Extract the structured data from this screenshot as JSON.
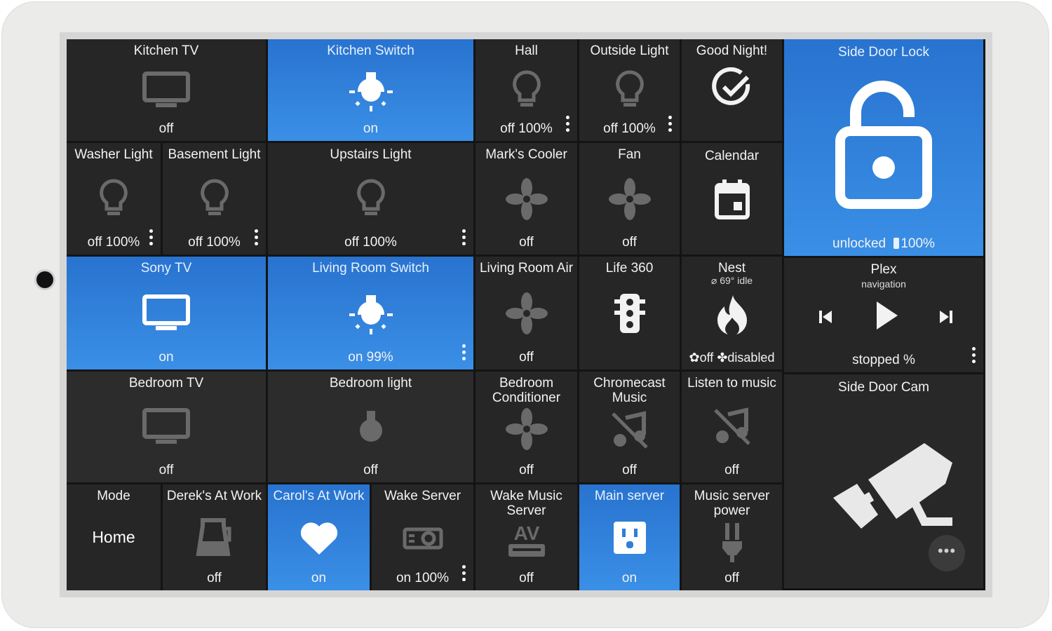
{
  "colors": {
    "accent_on": "#2f7fd8",
    "tile_off": "#262626",
    "icon_off": "#6a6a6a"
  },
  "tiles": {
    "kitchen_tv": {
      "title": "Kitchen TV",
      "state": "off",
      "icon": "tv-icon"
    },
    "kitchen_switch": {
      "title": "Kitchen Switch",
      "state": "on",
      "icon": "light-icon"
    },
    "hall": {
      "title": "Hall",
      "state": "off 100%",
      "icon": "bulb-icon"
    },
    "outside_light": {
      "title": "Outside Light",
      "state": "off 100%",
      "icon": "bulb-icon"
    },
    "good_night": {
      "title": "Good Night!",
      "icon": "checkmark-circle-icon"
    },
    "side_door_lock": {
      "title": "Side Door Lock",
      "state": "unlocked",
      "battery": "100%",
      "icon": "unlock-icon"
    },
    "washer_light": {
      "title": "Washer Light",
      "state": "off 100%",
      "icon": "bulb-icon"
    },
    "basement_light": {
      "title": "Basement Light",
      "state": "off 100%",
      "icon": "bulb-icon"
    },
    "upstairs_light": {
      "title": "Upstairs Light",
      "state": "off 100%",
      "icon": "bulb-icon"
    },
    "marks_cooler": {
      "title": "Mark's Cooler",
      "state": "off",
      "icon": "fan-icon"
    },
    "fan": {
      "title": "Fan",
      "state": "off",
      "icon": "fan-icon"
    },
    "calendar": {
      "title": "Calendar",
      "icon": "calendar-icon"
    },
    "sony_tv": {
      "title": "Sony TV",
      "state": "on",
      "icon": "tv-icon"
    },
    "living_room_switch": {
      "title": "Living Room Switch",
      "state": "on 99%",
      "icon": "light-icon"
    },
    "living_room_air": {
      "title": "Living Room Air",
      "state": "off",
      "icon": "fan-icon"
    },
    "life360": {
      "title": "Life 360",
      "icon": "traffic-light-icon"
    },
    "nest": {
      "title": "Nest",
      "sub": "69° idle",
      "state": "off",
      "state2": "disabled",
      "icon": "flame-icon"
    },
    "plex": {
      "title": "Plex",
      "sub": "navigation",
      "state": "stopped %",
      "icon": "play-icon"
    },
    "bedroom_tv": {
      "title": "Bedroom TV",
      "state": "off",
      "icon": "tv-icon"
    },
    "bedroom_light": {
      "title": "Bedroom light",
      "state": "off",
      "icon": "light-icon"
    },
    "bedroom_conditioner": {
      "title": "Bedroom Conditioner",
      "state": "off",
      "icon": "fan-icon"
    },
    "chromecast_music": {
      "title": "Chromecast Music",
      "state": "off",
      "icon": "music-off-icon"
    },
    "listen_to_music": {
      "title": "Listen to music",
      "state": "off",
      "icon": "music-off-icon"
    },
    "side_door_cam": {
      "title": "Side Door Cam",
      "icon": "security-camera-icon"
    },
    "mode": {
      "title": "Mode",
      "value": "Home"
    },
    "dereks_at_work": {
      "title": "Derek's At Work",
      "state": "off",
      "icon": "coffee-pot-icon"
    },
    "carols_at_work": {
      "title": "Carol's At Work",
      "state": "on",
      "icon": "heart-icon"
    },
    "wake_server": {
      "title": "Wake Server",
      "state": "on 100%",
      "icon": "projector-icon"
    },
    "wake_music_server": {
      "title": "Wake Music Server",
      "state": "off",
      "icon": "av-receiver-icon"
    },
    "main_server": {
      "title": "Main server",
      "state": "on",
      "icon": "outlet-icon"
    },
    "music_server_power": {
      "title": "Music server power",
      "state": "off",
      "icon": "plug-icon"
    }
  },
  "fab": {
    "label": "•••"
  }
}
